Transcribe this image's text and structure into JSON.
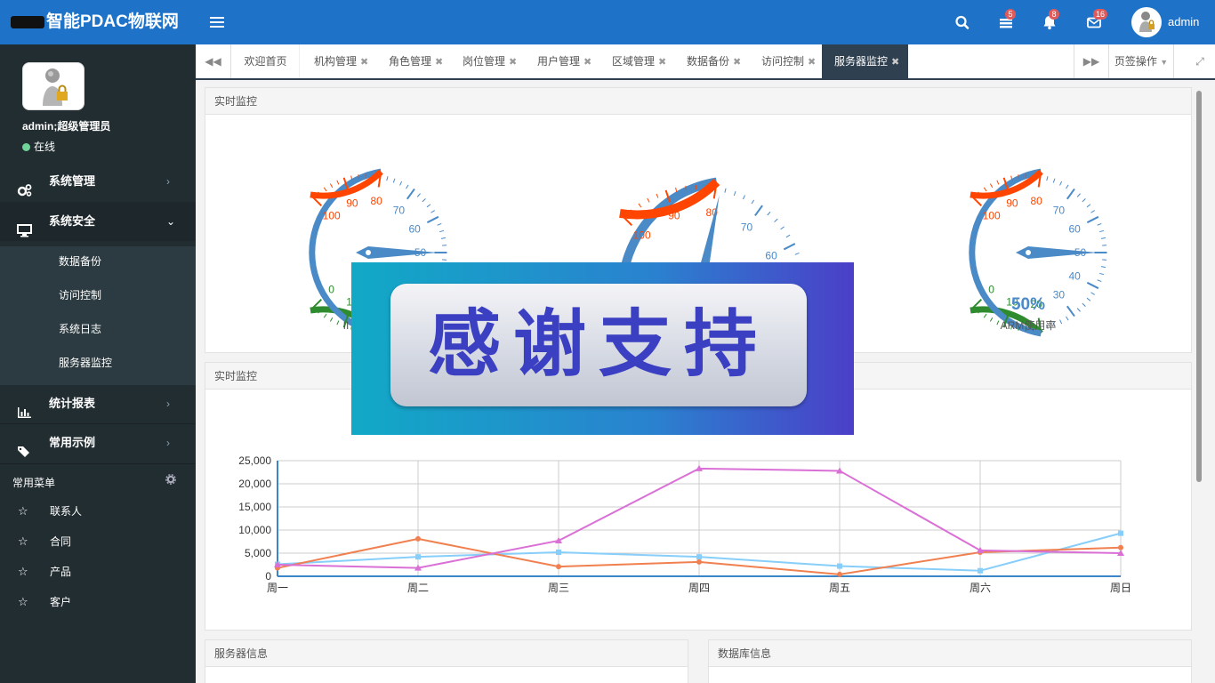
{
  "app": {
    "title": "智能PDAC物联网",
    "badges": {
      "tasks": "5",
      "notifications": "8",
      "messages": "16"
    },
    "user": "admin"
  },
  "sidebar": {
    "profile_name": "admin;超级管理员",
    "profile_status": "在线",
    "menus": [
      {
        "label": "系统管理",
        "icon": "gears-icon"
      },
      {
        "label": "系统安全",
        "icon": "monitor-icon"
      },
      {
        "label": "统计报表",
        "icon": "bar-chart-icon"
      },
      {
        "label": "常用示例",
        "icon": "tags-icon"
      }
    ],
    "submenu": [
      "数据备份",
      "访问控制",
      "系统日志",
      "服务器监控"
    ],
    "fav_header": "常用菜单",
    "favorites": [
      "联系人",
      "合同",
      "产品",
      "客户"
    ]
  },
  "tabs": {
    "items": [
      "欢迎首页",
      "机构管理",
      "角色管理",
      "岗位管理",
      "用户管理",
      "区域管理",
      "数据备份",
      "访问控制",
      "服务器监控"
    ],
    "active": 8,
    "ops_label": "页签操作"
  },
  "panels": {
    "monitor1": "实时监控",
    "monitor2": "实时监控",
    "server_info": "服务器信息",
    "db_info": "数据库信息"
  },
  "gauges": [
    {
      "label": "II",
      "value": 50,
      "show_value": false
    },
    {
      "label": "",
      "value": 79,
      "show_value": false
    },
    {
      "label": "ARM使用率",
      "value": 50,
      "value_text": "50%",
      "show_value": true
    }
  ],
  "overlay": {
    "text": "感谢支持"
  },
  "colors": {
    "topbar": "#1e73c8",
    "sidebar": "#222d32",
    "gauge_blue": "#4a8ac7",
    "gauge_green": "#2e8b2e",
    "gauge_red": "#ff4500"
  },
  "chart_data": {
    "type": "line",
    "x": [
      "周一",
      "周二",
      "周三",
      "周四",
      "周五",
      "周六",
      "周日"
    ],
    "ylim": [
      0,
      25000
    ],
    "yticks": [
      "0",
      "5,000",
      "10,000",
      "15,000",
      "20,000",
      "25,000"
    ],
    "grid": true,
    "series": [
      {
        "values": [
          2600,
          4200,
          5200,
          4200,
          2200,
          1200,
          9300
        ],
        "color": "#87cefa",
        "marker": "square"
      },
      {
        "values": [
          1800,
          8100,
          2100,
          3100,
          400,
          5200,
          6200
        ],
        "color": "#f08050",
        "marker": "circle"
      },
      {
        "values": [
          2500,
          1800,
          7700,
          23300,
          22800,
          5600,
          5000
        ],
        "color": "#da70d6",
        "marker": "triangle"
      }
    ]
  }
}
